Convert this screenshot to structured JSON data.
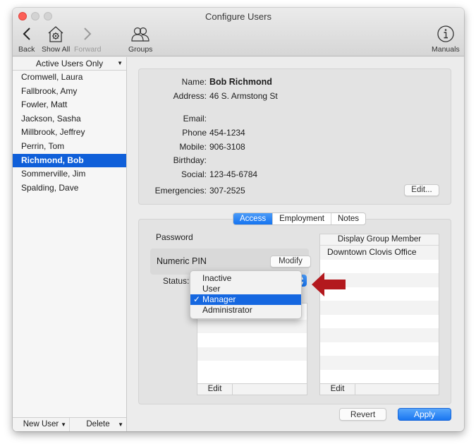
{
  "window": {
    "title": "Configure Users"
  },
  "toolbar": {
    "back": {
      "label": "Back",
      "icon": "chevron-left-icon"
    },
    "show_all": {
      "label": "Show All",
      "icon": "house-gear-icon"
    },
    "forward": {
      "label": "Forward",
      "icon": "chevron-right-icon",
      "disabled": true
    },
    "groups": {
      "label": "Groups",
      "icon": "people-icon"
    },
    "manuals": {
      "label": "Manuals",
      "icon": "info-circle-icon"
    }
  },
  "sidebar": {
    "filter": "Active Users Only",
    "users": [
      {
        "name": "Cromwell, Laura",
        "selected": false
      },
      {
        "name": "Fallbrook, Amy",
        "selected": false
      },
      {
        "name": "Fowler, Matt",
        "selected": false
      },
      {
        "name": "Jackson, Sasha",
        "selected": false
      },
      {
        "name": "Millbrook, Jeffrey",
        "selected": false
      },
      {
        "name": "Perrin, Tom",
        "selected": false
      },
      {
        "name": "Richmond, Bob",
        "selected": true
      },
      {
        "name": "Sommerville, Jim",
        "selected": false
      },
      {
        "name": "Spalding, Dave",
        "selected": false
      }
    ],
    "new_user": "New User",
    "delete": "Delete"
  },
  "info": {
    "fields": [
      {
        "key": "Name:",
        "value": "Bob Richmond"
      },
      {
        "key": "Address:",
        "value": "46 S. Armstong St"
      },
      {
        "key": "Email:",
        "value": ""
      },
      {
        "key": "Phone",
        "value": "454-1234"
      },
      {
        "key": "Mobile:",
        "value": "906-3108"
      },
      {
        "key": "Birthday:",
        "value": ""
      },
      {
        "key": "Social:",
        "value": "123-45-6784"
      },
      {
        "key": "Emergencies:",
        "value": "307-2525"
      }
    ],
    "edit_button": "Edit..."
  },
  "tabs": {
    "items": [
      "Access",
      "Employment",
      "Notes"
    ],
    "active": "Access"
  },
  "access": {
    "password_label": "Password",
    "pin_label": "Numeric PIN",
    "modify_button": "Modify",
    "status_label": "Status:",
    "status_options": [
      "Inactive",
      "User",
      "Manager",
      "Administrator"
    ],
    "status_selected": "Manager",
    "check_mark": "✓",
    "left_list": {
      "edit": "Edit"
    },
    "group_list": {
      "header": "Display Group Member",
      "rows": [
        "Downtown Clovis Office"
      ],
      "edit": "Edit"
    }
  },
  "footer": {
    "revert": "Revert",
    "apply": "Apply"
  },
  "annotation": {
    "arrow_color": "#b3191e"
  }
}
